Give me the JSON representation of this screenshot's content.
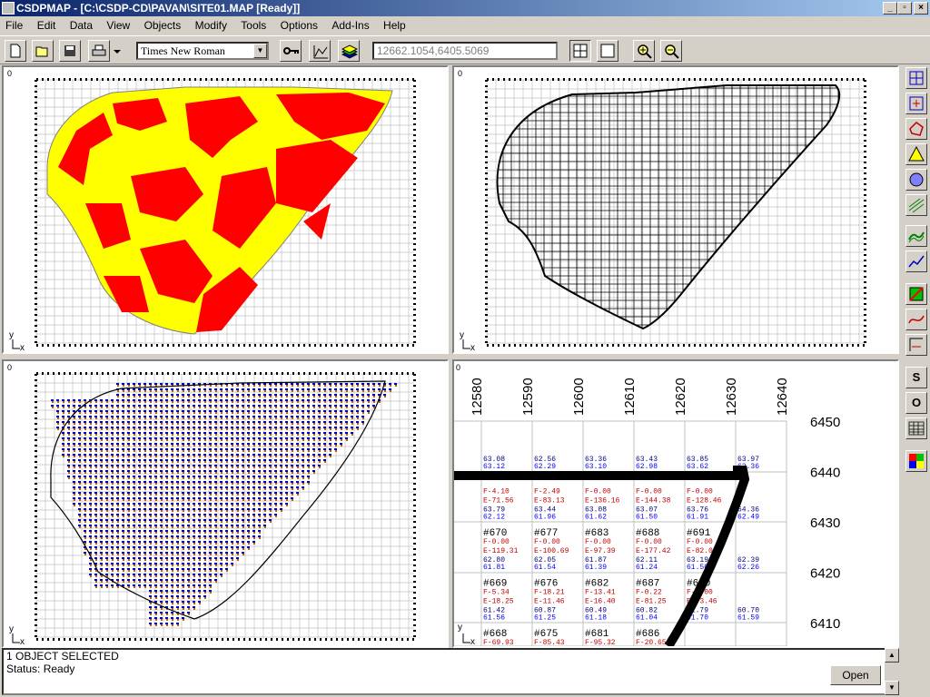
{
  "window": {
    "title": "CSDPMAP - [C:\\CSDP-CD\\PAVAN\\SITE01.MAP [Ready]]",
    "minimize": "_",
    "restore": "▫",
    "close": "×"
  },
  "menu": [
    "File",
    "Edit",
    "Data",
    "View",
    "Objects",
    "Modify",
    "Tools",
    "Options",
    "Add-Ins",
    "Help"
  ],
  "toolbar": {
    "font_value": "Times New Roman",
    "coordinates": "12662.1054,6405.5069"
  },
  "panels": {
    "origin_label": "0",
    "y_axis": "y",
    "x_axis": "x"
  },
  "data_view": {
    "x_ticks": [
      "12580",
      "12590",
      "12600",
      "12610",
      "12620",
      "12630",
      "12640"
    ],
    "y_ticks": [
      "6450",
      "6440",
      "6430",
      "6420",
      "6410"
    ],
    "rows": [
      {
        "cells": [
          {
            "id": "",
            "a": "",
            "b": "",
            "n1": "63.08",
            "n2": "63.12"
          },
          {
            "id": "",
            "a": "",
            "b": "",
            "n1": "62.56",
            "n2": "62.29"
          },
          {
            "id": "",
            "a": "",
            "b": "",
            "n1": "63.36",
            "n2": "63.10"
          },
          {
            "id": "",
            "a": "",
            "b": "",
            "n1": "63.43",
            "n2": "62.98"
          },
          {
            "id": "",
            "a": "",
            "b": "",
            "n1": "63.85",
            "n2": "63.62"
          },
          {
            "id": "",
            "a": "",
            "b": "",
            "n1": "63.97",
            "n2": "62.36"
          }
        ]
      },
      {
        "cells": [
          {
            "id": "",
            "a": "F-4.10",
            "b": "E-71.56",
            "n1": "63.79",
            "n2": "62.12"
          },
          {
            "id": "",
            "a": "F-2.49",
            "b": "E-83.13",
            "n1": "63.44",
            "n2": "61.96"
          },
          {
            "id": "",
            "a": "F-0.00",
            "b": "E-136.16",
            "n1": "63.08",
            "n2": "61.62"
          },
          {
            "id": "",
            "a": "F-0.00",
            "b": "E-144.38",
            "n1": "63.07",
            "n2": "61.50"
          },
          {
            "id": "",
            "a": "F-0.00",
            "b": "E-128.46",
            "n1": "63.76",
            "n2": "61.91"
          },
          {
            "id": "",
            "a": "",
            "b": "",
            "n1": "64.36",
            "n2": "62.49"
          }
        ]
      },
      {
        "cells": [
          {
            "id": "#670",
            "a": "F-0.00",
            "b": "E-119.31",
            "n1": "62.80",
            "n2": "61.81"
          },
          {
            "id": "#677",
            "a": "F-0.00",
            "b": "E-100.69",
            "n1": "62.05",
            "n2": "61.54"
          },
          {
            "id": "#683",
            "a": "F-0.00",
            "b": "E-97.39",
            "n1": "61.87",
            "n2": "61.39"
          },
          {
            "id": "#688",
            "a": "F-0.00",
            "b": "E-177.42",
            "n1": "62.11",
            "n2": "61.24"
          },
          {
            "id": "#691",
            "a": "F-0.00",
            "b": "E-82.01",
            "n1": "63.19",
            "n2": "61.50"
          },
          {
            "id": "",
            "a": "",
            "b": "",
            "n1": "62.39",
            "n2": "62.26"
          }
        ]
      },
      {
        "cells": [
          {
            "id": "#669",
            "a": "F-5.34",
            "b": "E-18.25",
            "n1": "61.42",
            "n2": "61.56"
          },
          {
            "id": "#676",
            "a": "F-18.21",
            "b": "E-11.46",
            "n1": "60.87",
            "n2": "61.25"
          },
          {
            "id": "#682",
            "a": "F-13.41",
            "b": "E-16.40",
            "n1": "60.49",
            "n2": "61.18"
          },
          {
            "id": "#687",
            "a": "F-0.22",
            "b": "E-81.25",
            "n1": "60.82",
            "n2": "61.04"
          },
          {
            "id": "#690",
            "a": "F-0.00",
            "b": "E-73.46",
            "n1": "61.79",
            "n2": "61.70"
          },
          {
            "id": "",
            "a": "",
            "b": "",
            "n1": "60.70",
            "n2": "61.59"
          }
        ]
      },
      {
        "cells": [
          {
            "id": "#668",
            "a": "F-69.93",
            "b": "",
            "n1": "",
            "n2": ""
          },
          {
            "id": "#675",
            "a": "F-85.43",
            "b": "",
            "n1": "",
            "n2": ""
          },
          {
            "id": "#681",
            "a": "F-95.32",
            "b": "",
            "n1": "",
            "n2": ""
          },
          {
            "id": "#686",
            "a": "F-20.65",
            "b": "",
            "n1": "",
            "n2": ""
          },
          {
            "id": "",
            "a": "",
            "b": "",
            "n1": "",
            "n2": ""
          },
          {
            "id": "",
            "a": "",
            "b": "",
            "n1": "",
            "n2": ""
          }
        ]
      }
    ]
  },
  "rightbar": {
    "s_label": "S",
    "o_label": "O"
  },
  "status": {
    "line1": "1 OBJECT SELECTED",
    "line2": "Status: Ready",
    "open_label": "Open"
  },
  "colors": {
    "fill_yellow": "#ffff00",
    "fill_red": "#ff0000",
    "grid": "#c0c0c0",
    "title_blue": "#0a246a",
    "value_blue": "#0000ff",
    "value_red": "#c00000"
  }
}
